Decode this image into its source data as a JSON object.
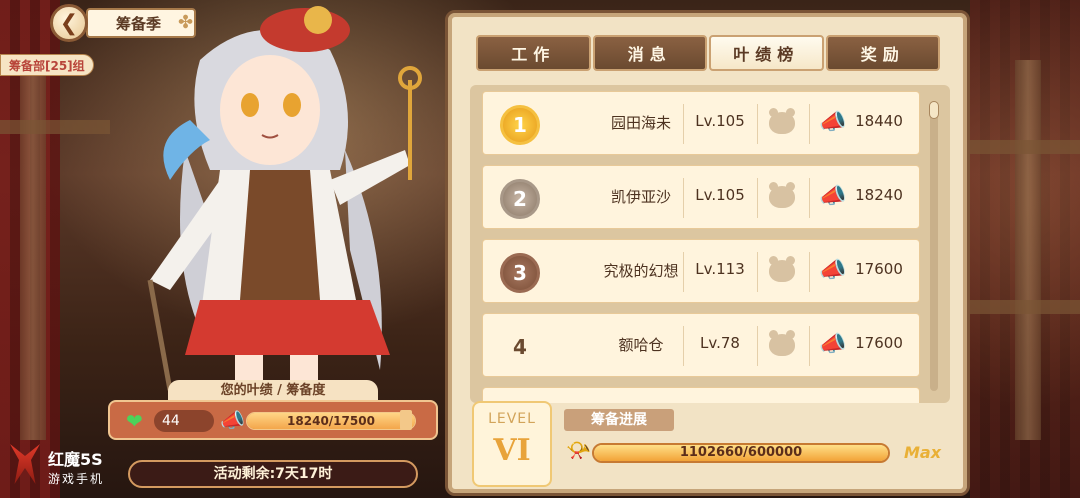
{
  "header": {
    "back_icon": "heart-back-icon",
    "title": "筹备季",
    "group_tag": "筹备部[25]组"
  },
  "tabs": [
    {
      "label": "工作",
      "active": false
    },
    {
      "label": "消息",
      "active": false
    },
    {
      "label": "叶绩榜",
      "active": true
    },
    {
      "label": "奖励",
      "active": false
    }
  ],
  "leaderboard": [
    {
      "rank": "1",
      "name": "园田海未",
      "level": "Lv.105",
      "score": "18440"
    },
    {
      "rank": "2",
      "name": "凯伊亚沙",
      "level": "Lv.105",
      "score": "18240"
    },
    {
      "rank": "3",
      "name": "究极的幻想",
      "level": "Lv.113",
      "score": "17600"
    },
    {
      "rank": "4",
      "name": "额哈仓",
      "level": "Lv.78",
      "score": "17600"
    }
  ],
  "progress": {
    "level_word": "LEVEL",
    "level_num": "VI",
    "label": "筹备进展",
    "value": "1102660/600000",
    "fill": 1.0,
    "max_label": "Max"
  },
  "performance": {
    "title": "您的叶绩 / 筹备度",
    "hearts": "44",
    "bar_text": "18240/17500",
    "fill": 1.0
  },
  "event_timer": "活动剩余:7天17时",
  "brand": {
    "name": "红魔5S",
    "sub": "游戏手机"
  },
  "colors": {
    "accent": "#7a5436",
    "heart": "#4bd35a",
    "horn": "#d7392f"
  }
}
